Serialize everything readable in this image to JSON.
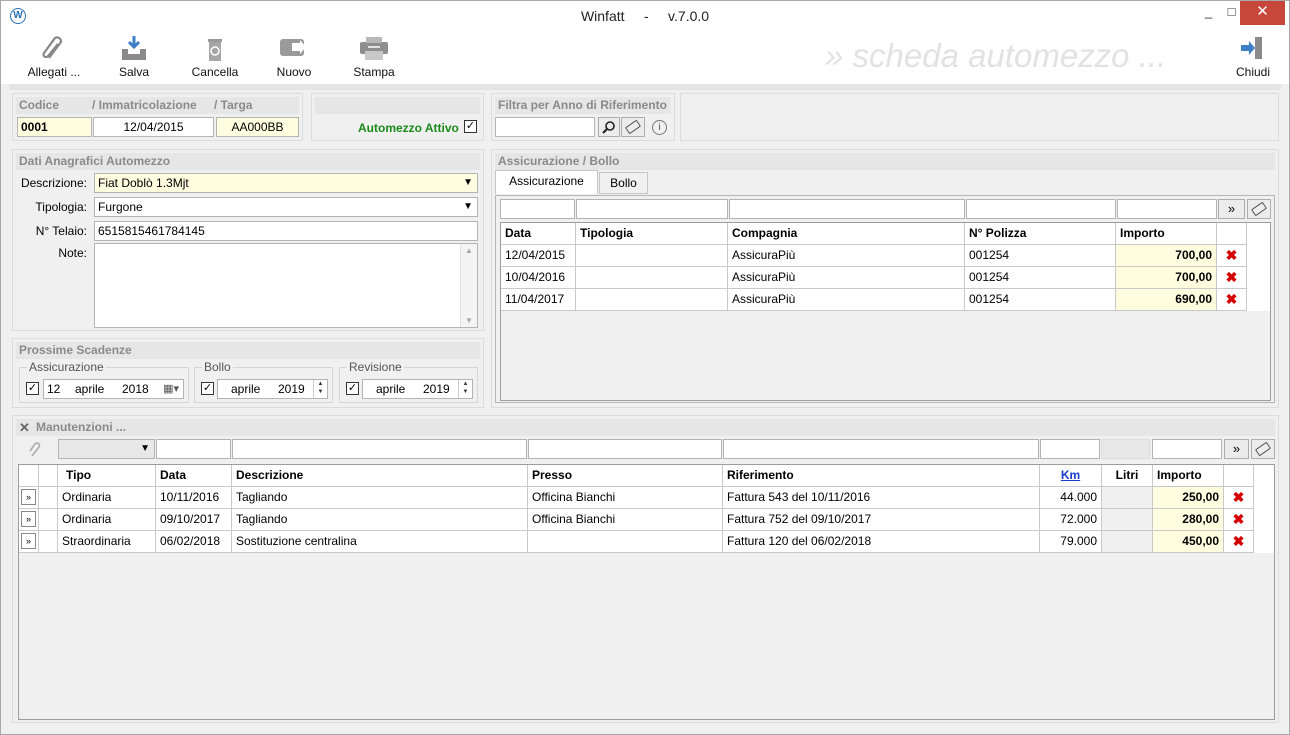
{
  "window": {
    "title": "Winfatt     -     v.7.0.0",
    "app_icon_glyph": "W",
    "minimize": "_",
    "maximize": "□",
    "close": "✕"
  },
  "toolbar": {
    "allegati": "Allegati ...",
    "salva": "Salva",
    "cancella": "Cancella",
    "nuovo": "Nuovo",
    "stampa": "Stampa",
    "chiudi": "Chiudi",
    "watermark": "» scheda automezzo ..."
  },
  "id_panel": {
    "codice_label": "Codice",
    "immatricolazione_label": "/ Immatricolazione",
    "targa_label": "/ Targa",
    "codice": "0001",
    "immatricolazione": "12/04/2015",
    "targa": "AA000BB"
  },
  "attivo": {
    "label": "Automezzo Attivo",
    "checked": "✓"
  },
  "filtro": {
    "label": "Filtra per Anno di Riferimento",
    "value": "",
    "info": "i"
  },
  "anagrafica": {
    "header": "Dati Anagrafici Automezzo",
    "descrizione_label": "Descrizione:",
    "descrizione": "Fiat Doblò 1.3Mjt",
    "tipologia_label": "Tipologia:",
    "tipologia": "Furgone",
    "telaio_label": "N° Telaio:",
    "telaio": "6515815461784145",
    "note_label": "Note:",
    "note": ""
  },
  "scadenze": {
    "header": "Prossime Scadenze",
    "assicurazione": {
      "label": "Assicurazione",
      "day": "12",
      "month": "aprile",
      "year": "2018",
      "checked": "✓"
    },
    "bollo": {
      "label": "Bollo",
      "month": "aprile",
      "year": "2019",
      "checked": "✓"
    },
    "revisione": {
      "label": "Revisione",
      "month": "aprile",
      "year": "2019",
      "checked": "✓"
    }
  },
  "assicurazione_bollo": {
    "header": "Assicurazione / Bollo",
    "tabs": [
      "Assicurazione",
      "Bollo"
    ],
    "go": "»",
    "columns": [
      "Data",
      "Tipologia",
      "Compagnia",
      "N° Polizza",
      "Importo"
    ],
    "rows": [
      {
        "data": "12/04/2015",
        "tipologia": "",
        "compagnia": "AssicuraPiù",
        "polizza": "001254",
        "importo": "700,00"
      },
      {
        "data": "10/04/2016",
        "tipologia": "",
        "compagnia": "AssicuraPiù",
        "polizza": "001254",
        "importo": "700,00"
      },
      {
        "data": "11/04/2017",
        "tipologia": "",
        "compagnia": "AssicuraPiù",
        "polizza": "001254",
        "importo": "690,00"
      }
    ],
    "delete_glyph": "✖"
  },
  "manutenzioni": {
    "header": "Manutenzioni ...",
    "go": "»",
    "columns": [
      "Tipo",
      "Data",
      "Descrizione",
      "Presso",
      "Riferimento",
      "Km",
      "Litri",
      "Importo"
    ],
    "rows": [
      {
        "tipo": "Ordinaria",
        "data": "10/11/2016",
        "descrizione": "Tagliando",
        "presso": "Officina Bianchi",
        "riferimento": "Fattura 543 del 10/11/2016",
        "km": "44.000",
        "litri": "",
        "importo": "250,00"
      },
      {
        "tipo": "Ordinaria",
        "data": "09/10/2017",
        "descrizione": "Tagliando",
        "presso": "Officina Bianchi",
        "riferimento": "Fattura 752 del 09/10/2017",
        "km": "72.000",
        "litri": "",
        "importo": "280,00"
      },
      {
        "tipo": "Straordinaria",
        "data": "06/02/2018",
        "descrizione": "Sostituzione centralina",
        "presso": "",
        "riferimento": "Fattura 120 del 06/02/2018",
        "km": "79.000",
        "litri": "",
        "importo": "450,00"
      }
    ],
    "row_button": "»",
    "delete_glyph": "✖"
  },
  "colors": {
    "accent_green": "#1a8a1a",
    "highlight_yellow": "#fffde0",
    "delete_red": "#d40000",
    "link_blue": "#1a3ccc",
    "close_red": "#c7473a"
  }
}
